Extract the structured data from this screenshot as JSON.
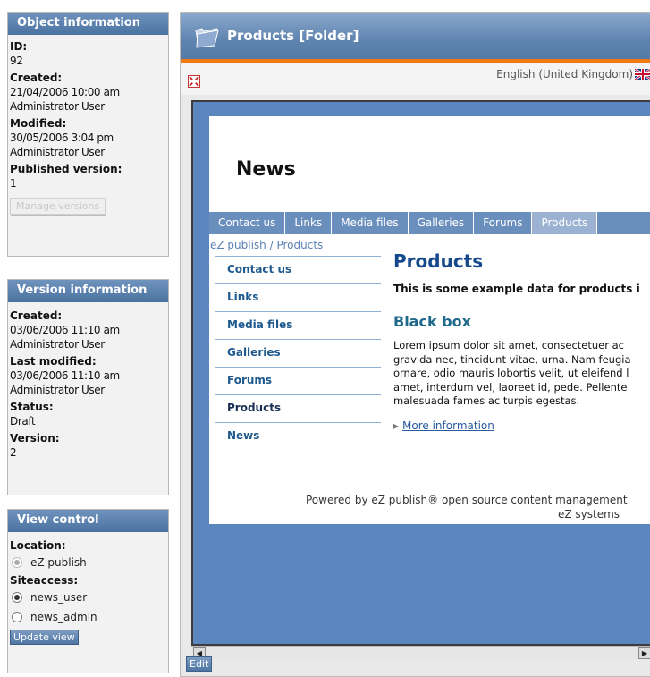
{
  "object_info": {
    "title": "Object information",
    "id_label": "ID:",
    "id_value": "92",
    "created_label": "Created:",
    "created_date": "21/04/2006 10:00 am",
    "created_by": "Administrator User",
    "modified_label": "Modified:",
    "modified_date": "30/05/2006 3:04 pm",
    "modified_by": "Administrator User",
    "published_label": "Published version:",
    "published_value": "1",
    "manage_versions_button": "Manage versions"
  },
  "version_info": {
    "title": "Version information",
    "created_label": "Created:",
    "created_date": "03/06/2006 11:10 am",
    "created_by": "Administrator User",
    "last_modified_label": "Last modified:",
    "last_modified_date": "03/06/2006 11:10 am",
    "last_modified_by": "Administrator User",
    "status_label": "Status:",
    "status_value": "Draft",
    "version_label": "Version:",
    "version_value": "2"
  },
  "view_control": {
    "title": "View control",
    "location_label": "Location:",
    "location_option": "eZ publish",
    "siteaccess_label": "Siteaccess:",
    "siteaccess_options": [
      "news_user",
      "news_admin"
    ],
    "selected_siteaccess": "news_user",
    "update_button": "Update view"
  },
  "main": {
    "title": "Products [Folder]",
    "language": "English (United Kingdom)",
    "edit_button": "Edit"
  },
  "site_preview": {
    "site_title": "News",
    "tabs": [
      "Contact us",
      "Links",
      "Media files",
      "Galleries",
      "Forums",
      "Products"
    ],
    "active_tab": "Products",
    "path": "eZ publish / Products",
    "left_menu": [
      "Contact us",
      "Links",
      "Media files",
      "Galleries",
      "Forums",
      "Products",
      "News"
    ],
    "current_menu": "Products",
    "heading": "Products",
    "intro": "This is some example data for products i",
    "subheading": "Black box",
    "body_lines": [
      "Lorem ipsum dolor sit amet, consectetuer ac",
      "gravida nec, tincidunt vitae, urna. Nam feugia",
      "ornare, odio mauris lobortis velit, ut eleifend l",
      "amet, interdum vel, laoreet id, pede. Pellente",
      "malesuada fames ac turpis egestas."
    ],
    "more_link": "More information",
    "footer_line1": "Powered by eZ publish® open source content management",
    "footer_line2": "eZ systems"
  },
  "colors": {
    "header_blue": "#4b72a0",
    "accent_orange": "#f07a12",
    "preview_bg": "#5b86bf",
    "heading_blue": "#15498c"
  }
}
